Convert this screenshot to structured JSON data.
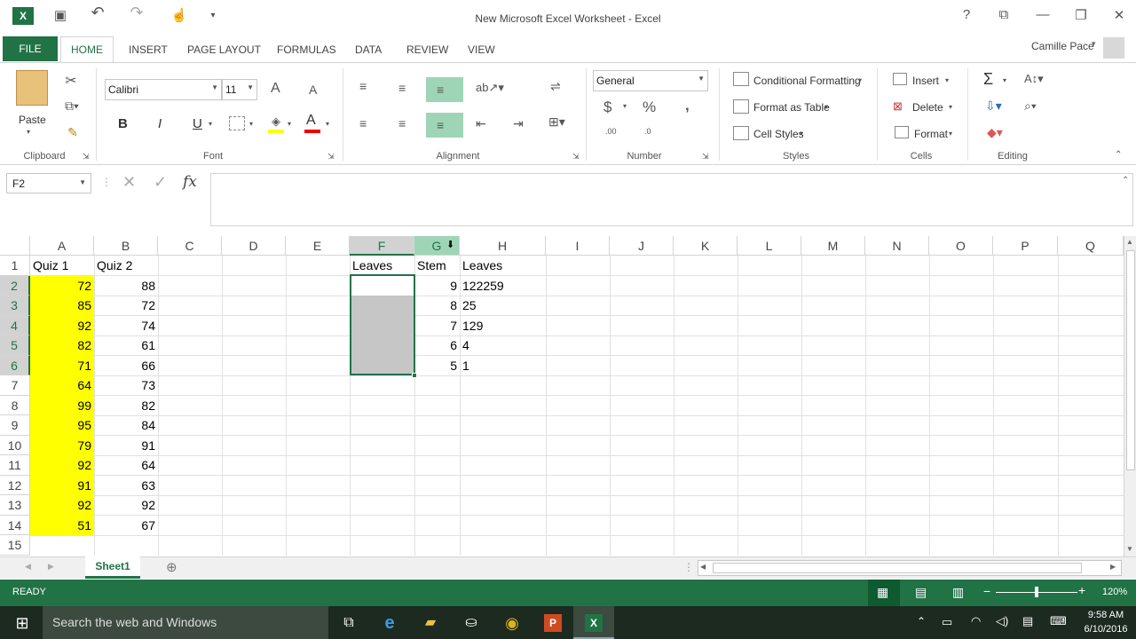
{
  "window": {
    "title": "New Microsoft Excel Worksheet - Excel",
    "help": "?",
    "minimize": "—",
    "restore": "❐",
    "close": "✕",
    "ribbon_display": "⧉"
  },
  "quick_access": {
    "app_icon": "excel-icon",
    "save": "💾",
    "undo": "↶",
    "redo": "↷",
    "touch": "☝",
    "customize": "▾"
  },
  "tabs": [
    {
      "label": "FILE"
    },
    {
      "label": "HOME"
    },
    {
      "label": "INSERT"
    },
    {
      "label": "PAGE LAYOUT"
    },
    {
      "label": "FORMULAS"
    },
    {
      "label": "DATA"
    },
    {
      "label": "REVIEW"
    },
    {
      "label": "VIEW"
    }
  ],
  "user": {
    "name": "Camille Pace"
  },
  "ribbon": {
    "clipboard": {
      "label": "Clipboard",
      "paste": "Paste"
    },
    "font": {
      "label": "Font",
      "family": "Calibri",
      "size": "11",
      "bold": "B",
      "italic": "I",
      "underline": "U",
      "grow": "A",
      "shrink": "A"
    },
    "alignment": {
      "label": "Alignment"
    },
    "number": {
      "label": "Number",
      "format": "General",
      "currency": "$",
      "percent": "%",
      "comma": ",",
      "inc_decimal": ".00",
      "dec_decimal": ".0"
    },
    "styles": {
      "label": "Styles",
      "conditional": "Conditional Formatting",
      "format_table": "Format as Table",
      "cell_styles": "Cell Styles"
    },
    "cells": {
      "label": "Cells",
      "insert": "Insert",
      "delete": "Delete",
      "format": "Format"
    },
    "editing": {
      "label": "Editing",
      "sum": "Σ"
    }
  },
  "formula_bar": {
    "name_box": "F2",
    "fx": "fx",
    "cancel": "✕",
    "enter": "✓",
    "content": ""
  },
  "columns": [
    "A",
    "B",
    "C",
    "D",
    "E",
    "F",
    "G",
    "H",
    "I",
    "J",
    "K",
    "L",
    "M",
    "N",
    "O",
    "P",
    "Q"
  ],
  "rows": [
    "1",
    "2",
    "3",
    "4",
    "5",
    "6",
    "7",
    "8",
    "9",
    "10",
    "11",
    "12",
    "13",
    "14",
    "15"
  ],
  "cells": {
    "header": {
      "a": "Quiz 1",
      "b": "Quiz 2",
      "f": "Leaves",
      "g": "Stem",
      "h": "Leaves"
    },
    "quiz1": [
      "72",
      "85",
      "92",
      "82",
      "71",
      "64",
      "99",
      "95",
      "79",
      "92",
      "91",
      "92",
      "51"
    ],
    "quiz2": [
      "88",
      "72",
      "74",
      "61",
      "66",
      "73",
      "82",
      "84",
      "91",
      "64",
      "63",
      "92",
      "67"
    ],
    "stem": [
      "9",
      "8",
      "7",
      "6",
      "5"
    ],
    "leaves_right": [
      "122259",
      "25",
      "129",
      "4",
      "1"
    ]
  },
  "sheet": {
    "name": "Sheet1",
    "add": "⊕"
  },
  "status": {
    "ready": "READY",
    "zoom": "120%"
  },
  "taskbar": {
    "search": "Search the web and Windows",
    "time": "9:58 AM",
    "date": "6/10/2016"
  },
  "colors": {
    "accent": "#217346",
    "highlight": "#ffff00",
    "selection_fill": "#c6c6c6"
  }
}
